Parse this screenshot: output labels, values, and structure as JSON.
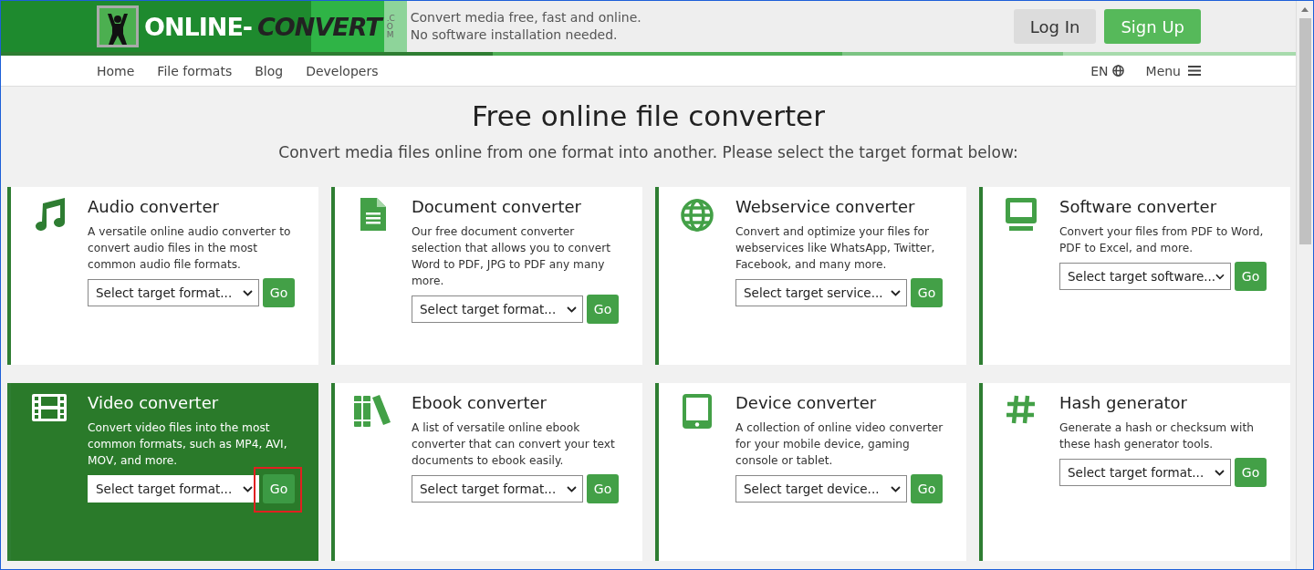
{
  "header": {
    "logo": {
      "word_a": "ONLINE-",
      "word_b": "CONVERT",
      "suffix": ".COM"
    },
    "tagline": "Convert media free, fast and online.",
    "subline": "No software installation needed.",
    "buttons": [
      {
        "label": "Log In",
        "kind": "secondary"
      },
      {
        "label": "Sign Up",
        "kind": "primary"
      }
    ]
  },
  "nav": {
    "items": [
      "Home",
      "File formats",
      "Blog",
      "Developers"
    ],
    "language": "EN",
    "menu": "Menu"
  },
  "hero": {
    "title": "Free online file converter",
    "subtitle": "Convert media files online from one format into another. Please select the target format below:"
  },
  "cards": [
    {
      "title": "Audio converter",
      "description": "A versatile online audio converter to convert audio files in the most common audio file formats.",
      "select": "Select target format...",
      "go": "Go",
      "highlighted": false,
      "marked": false
    },
    {
      "title": "Document converter",
      "description": "Our free document converter selection that allows you to convert Word to PDF, JPG to PDF any many more.",
      "select": "Select target format...",
      "go": "Go",
      "highlighted": false,
      "marked": false
    },
    {
      "title": "Webservice converter",
      "description": "Convert and optimize your files for webservices like WhatsApp, Twitter, Facebook, and many more.",
      "select": "Select target service...",
      "go": "Go",
      "highlighted": false,
      "marked": false
    },
    {
      "title": "Software converter",
      "description": "Convert your files from PDF to Word, PDF to Excel, and more.",
      "select": "Select target software...",
      "go": "Go",
      "highlighted": false,
      "marked": false
    },
    {
      "title": "Video converter",
      "description": "Convert video files into the most common formats, such as MP4, AVI, MOV, and more.",
      "select": "Select target format...",
      "go": "Go",
      "highlighted": true,
      "marked": true
    },
    {
      "title": "Ebook converter",
      "description": "A list of versatile online ebook converter that can convert your text documents to ebook easily.",
      "select": "Select target format...",
      "go": "Go",
      "highlighted": false,
      "marked": false
    },
    {
      "title": "Device converter",
      "description": "A collection of online video converter for your mobile device, gaming console or tablet.",
      "select": "Select target device...",
      "go": "Go",
      "highlighted": false,
      "marked": false
    },
    {
      "title": "Hash generator",
      "description": "Generate a hash or checksum with these hash generator tools.",
      "select": "Select target format...",
      "go": "Go",
      "highlighted": false,
      "marked": false
    }
  ]
}
